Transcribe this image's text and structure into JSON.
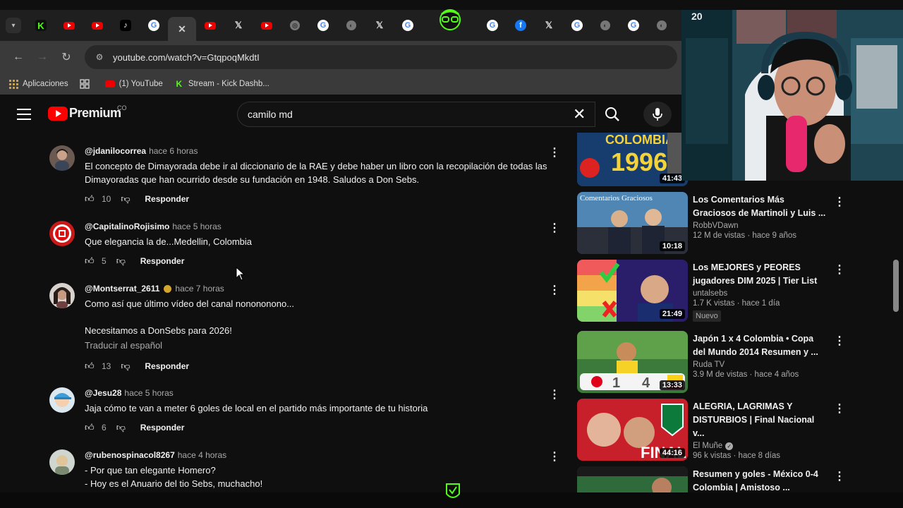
{
  "browser": {
    "url": "youtube.com/watch?v=GtqpoqMkdtI",
    "tabs": [
      "kick",
      "youtube",
      "youtube",
      "tiktok",
      "google",
      "close",
      "youtube",
      "x",
      "youtube",
      "google-alt",
      "google",
      "globe",
      "x",
      "google",
      "globe",
      "x",
      "google",
      "google",
      "facebook",
      "x",
      "google",
      "globe",
      "google",
      "globe"
    ],
    "bookmarks": [
      {
        "label": "Aplicaciones",
        "icon": "apps-icon"
      },
      {
        "label": "(1) YouTube",
        "icon": "youtube-icon"
      },
      {
        "label": "Stream - Kick Dashb...",
        "icon": "kick-icon"
      }
    ]
  },
  "youtube": {
    "logo_text": "Premium",
    "country_code": "CO",
    "search_query": "camilo md"
  },
  "comments": [
    {
      "author": "@jdanilocorrea",
      "time": "hace 6 horas",
      "text_lines": [
        "El concepto de Dimayorada debe ir al diccionario de la RAE y debe haber un libro con la recopilación de todas las",
        "Dimayoradas que han ocurrido desde su fundación en 1948. Saludos a Don Sebs."
      ],
      "likes": "10",
      "reply": "Responder"
    },
    {
      "author": "@CapitalinoRojisimo",
      "time": "hace 5 horas",
      "text_lines": [
        "Que elegancia la de...Medellin, Colombia"
      ],
      "likes": "5",
      "reply": "Responder"
    },
    {
      "author": "@Montserrat_2611",
      "time": "hace 7 horas",
      "text_lines": [
        "Como así que último vídeo del canal nonononono...",
        "",
        "Necesitamos a DonSebs para 2026!"
      ],
      "translate": "Traducir al español",
      "likes": "13",
      "reply": "Responder"
    },
    {
      "author": "@Jesu28",
      "time": "hace 5 horas",
      "text_lines": [
        "Jaja cómo te van a meter 6 goles de local en el partido más importante de tu historia"
      ],
      "likes": "6",
      "reply": "Responder"
    },
    {
      "author": "@rubenospinacol8267",
      "time": "hace 4 horas",
      "text_lines": [
        "- Por que tan elegante Homero?",
        "- Hoy es el Anuario del tio Sebs, muchacho!"
      ],
      "likes": "",
      "reply": ""
    }
  ],
  "videos": [
    {
      "title_lines": [],
      "channel": "",
      "meta": "",
      "duration": "41:43",
      "thumb_text": "COLOMBIA 1996"
    },
    {
      "title_lines": [
        "Los Comentarios Más",
        "Graciosos de Martinoli y Luis ..."
      ],
      "channel": "RobbVDawn",
      "meta": "12 M de vistas · hace 9 años",
      "duration": "10:18",
      "thumb_text": "Comentarios Graciosos"
    },
    {
      "title_lines": [
        "Los MEJORES y PEORES",
        "jugadores DIM 2025 | Tier List"
      ],
      "channel": "untalsebs",
      "meta": "1.7 K vistas · hace 1 día",
      "badge": "Nuevo",
      "duration": "21:49",
      "thumb_text": ""
    },
    {
      "title_lines": [
        "Japón 1 x 4 Colombia • Copa",
        "del Mundo 2014 Resumen y ..."
      ],
      "channel": "Ruda TV",
      "meta": "3.9 M de vistas · hace 4 años",
      "duration": "13:33",
      "thumb_text": "1 4"
    },
    {
      "title_lines": [
        "ALEGRIA, LAGRIMAS Y",
        "DISTURBIOS | Final Nacional v..."
      ],
      "channel": "El Muñe",
      "verified": true,
      "meta": "96 k vistas · hace 8 días",
      "duration": "44:16",
      "thumb_text": "FINAL"
    },
    {
      "title_lines": [
        "Resumen y goles - México 0-4",
        "Colombia | Amistoso ..."
      ],
      "channel": "",
      "meta": "",
      "duration": "",
      "thumb_text": ""
    }
  ]
}
